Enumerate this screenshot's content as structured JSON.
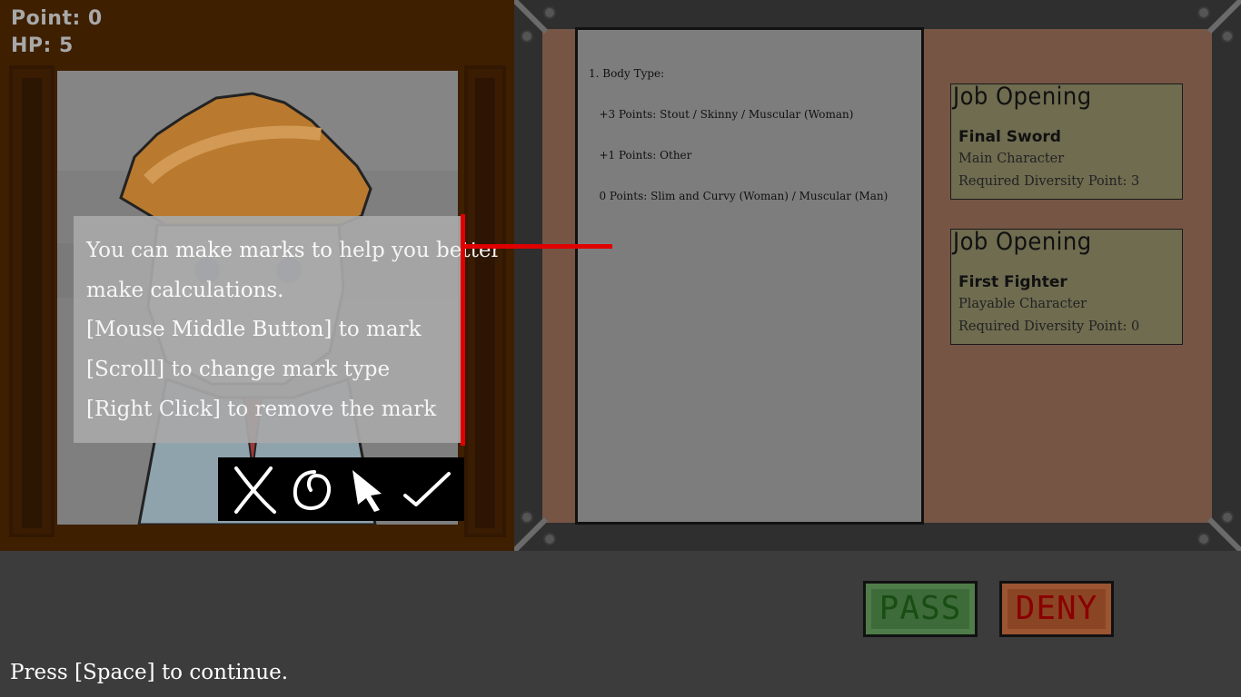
{
  "hud": {
    "points": "Point: 0",
    "hp": "HP: 5"
  },
  "document": {
    "lines": [
      "1. Body Type:",
      "   +3 Points: Stout / Skinny / Muscular (Woman)",
      "   +1 Points: Other",
      "   0 Points: Slim and Curvy (Woman) / Muscular (Man)"
    ]
  },
  "jobs": [
    {
      "heading": "Job Opening",
      "name": "Final Sword",
      "role": "Main Character",
      "diversity": "Required Diversity Point: 3"
    },
    {
      "heading": "Job Opening",
      "name": "First Fighter",
      "role": "Playable Character",
      "diversity": "Required Diversity Point: 0"
    }
  ],
  "tutorial": {
    "lines": [
      "You can make marks to help you better",
      "make calculations.",
      "[Mouse Middle Button] to mark",
      "[Scroll] to change mark type",
      "[Right Click]  to remove the mark"
    ]
  },
  "mark_types": [
    "cross-mark-icon",
    "circle-mark-icon",
    "cursor-icon",
    "check-mark-icon"
  ],
  "buttons": {
    "pass": "PASS",
    "deny": "DENY"
  },
  "prompt": "Press [Space] to continue.",
  "colors": {
    "pass": "#3e6b3a",
    "deny": "#8a4524",
    "accent_red": "#e00000"
  }
}
